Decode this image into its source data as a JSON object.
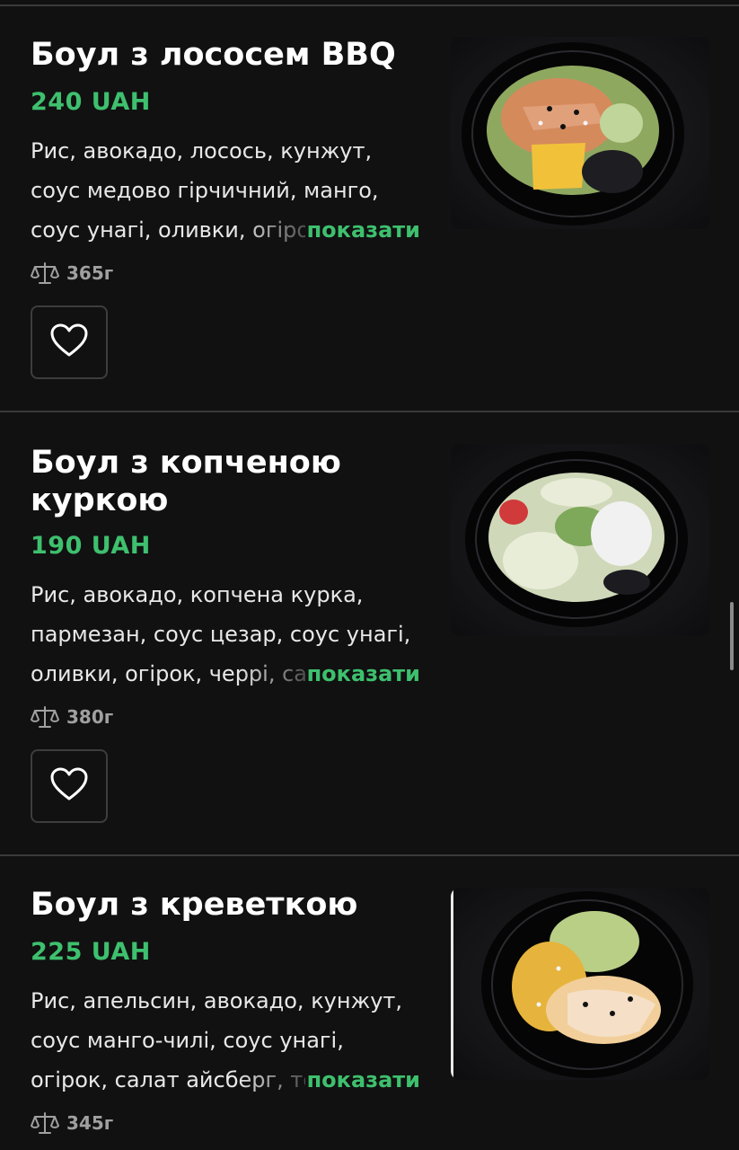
{
  "items": [
    {
      "title_lines": [
        "Боул з лососем BBQ"
      ],
      "price": "240 UAH",
      "desc_lines": [
        "Рис, авокадо, лосось, кунжут,",
        "соус медово гірчичний, манго,",
        "соус унагі, оливки, огірок"
      ],
      "show_more": "показати",
      "weight": "365г",
      "image": "bowl with salmon BBQ, mango, avocado and olives"
    },
    {
      "title_lines": [
        "Боул з копченою",
        "куркою"
      ],
      "price": "190 UAH",
      "desc_lines": [
        "Рис, авокадо, копчена курка,",
        "пармезан, соус цезар, соус унагі,",
        "оливки, огірок, черрі, салат"
      ],
      "show_more": "показати",
      "weight": "380г",
      "image": "bowl with smoked chicken, cucumber, cherry tomatoes and parmesan"
    },
    {
      "title_lines": [
        "Боул з креветкою"
      ],
      "price": "225 UAH",
      "desc_lines": [
        "Рис, апельсин, авокадо, кунжут,",
        "соус манго-чилі, соус унагі,",
        "огірок, салат айсберг, тобіко"
      ],
      "show_more": "показати",
      "weight": "345г",
      "image": "bowl with shrimp, orange, iceberg lettuce and sesame"
    }
  ],
  "icons": {
    "weight": "scale-icon",
    "favorite": "heart-outline-icon"
  },
  "colors": {
    "background": "#111111",
    "accent": "#3ec06e",
    "divider": "#3a3a3a",
    "muted": "#a0a0a0"
  }
}
